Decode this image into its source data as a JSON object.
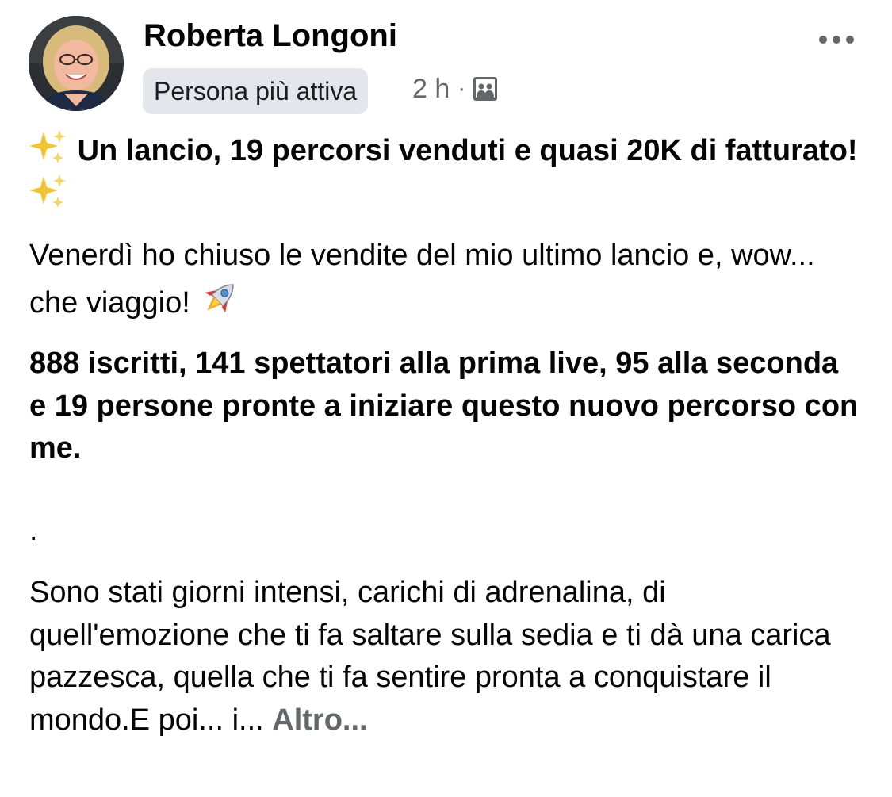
{
  "post": {
    "author_name": "Roberta Longoni",
    "badge": "Persona più attiva",
    "timestamp": "2 h",
    "separator": "·",
    "audience_icon": "group-audience-icon",
    "more_icon": "more-options-icon",
    "headline_part1": "Un lancio, 19 percorsi venduti e quasi 20K di fatturato!",
    "headline_emoji": "sparkles-icon",
    "body_para1": "Venerdì ho chiuso le vendite del mio ultimo lancio e, wow... che viaggio!",
    "body_para1_emoji": "rocket-icon",
    "stats_para": "888 iscritti, 141 spettatori alla prima live, 95 alla seconda e 19 persone pronte a iniziare questo nuovo percorso con me.",
    "dot_line": ".",
    "body_para2": "Sono stati giorni intensi, carichi di adrenalina, di quell'emozione che ti fa saltare sulla sedia e ti dà una carica pazzesca, quella che ti fa sentire pronta a conquistare il mondo.E poi... i...",
    "see_more_label": "Altro..."
  },
  "colors": {
    "text_primary": "#050505",
    "text_secondary": "#65676b",
    "badge_background": "#e4e6eb",
    "sparkle": "#f4c430"
  }
}
